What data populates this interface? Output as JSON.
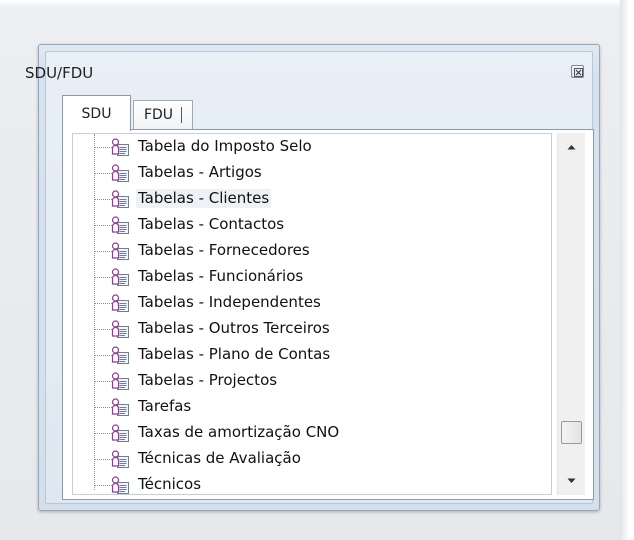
{
  "window": {
    "title": "SDU/FDU",
    "close_icon": "close-box-icon"
  },
  "tabs": [
    {
      "label": "SDU",
      "selected": true
    },
    {
      "label": "FDU",
      "selected": false
    }
  ],
  "tree": {
    "item_icon": "person-document-icon",
    "items": [
      {
        "label": "Tabela do Imposto Selo"
      },
      {
        "label": "Tabelas - Artigos"
      },
      {
        "label": "Tabelas - Clientes",
        "hovered": true
      },
      {
        "label": "Tabelas - Contactos"
      },
      {
        "label": "Tabelas - Fornecedores"
      },
      {
        "label": "Tabelas - Funcionários"
      },
      {
        "label": "Tabelas - Independentes"
      },
      {
        "label": "Tabelas - Outros Terceiros"
      },
      {
        "label": "Tabelas - Plano de Contas"
      },
      {
        "label": "Tabelas - Projectos"
      },
      {
        "label": "Tarefas"
      },
      {
        "label": "Taxas de amortização CNO"
      },
      {
        "label": "Técnicas de Avaliação"
      },
      {
        "label": "Técnicos"
      }
    ]
  },
  "scrollbar": {
    "position_fraction": 0.92,
    "up_icon": "scroll-up-arrow-icon",
    "down_icon": "scroll-down-arrow-icon"
  },
  "colors": {
    "dialog_background": "#d6e2ef",
    "hover_background": "#eef1f5",
    "icon_person": "#8a3f8f",
    "icon_document": "#6f7f90"
  }
}
